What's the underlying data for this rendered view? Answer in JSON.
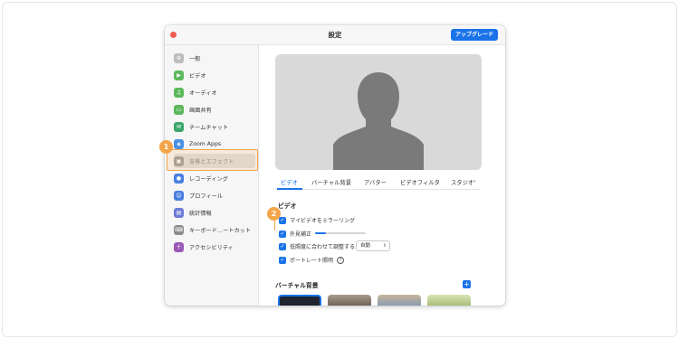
{
  "window": {
    "title": "設定",
    "upgrade_label": "アップグレード"
  },
  "sidebar": {
    "items": [
      {
        "label": "一般",
        "icon": "gear-icon",
        "color": "#bdbdbd"
      },
      {
        "label": "ビデオ",
        "icon": "video-icon",
        "color": "#5cb85c"
      },
      {
        "label": "オーディオ",
        "icon": "headphones-icon",
        "color": "#5cb85c"
      },
      {
        "label": "画面共有",
        "icon": "screen-share-icon",
        "color": "#5cb85c"
      },
      {
        "label": "チームチャット",
        "icon": "chat-icon",
        "color": "#3aa76d"
      },
      {
        "label": "Zoom Apps",
        "icon": "zoom-apps-icon",
        "color": "#4a90e2"
      },
      {
        "label": "背景とエフェクト",
        "icon": "background-icon",
        "color": "#9e9e9e"
      },
      {
        "label": "レコーディング",
        "icon": "record-icon",
        "color": "#4a7fe0"
      },
      {
        "label": "プロフィール",
        "icon": "profile-icon",
        "color": "#4a7fe0"
      },
      {
        "label": "統計情報",
        "icon": "statistics-icon",
        "color": "#6b7bd6"
      },
      {
        "label": "キーボード…ートカット",
        "icon": "keyboard-icon",
        "color": "#8c8c8c"
      },
      {
        "label": "アクセシビリティ",
        "icon": "accessibility-icon",
        "color": "#9b59b6"
      }
    ]
  },
  "callouts": {
    "one": "1",
    "two": "2"
  },
  "tabs": [
    "ビデオ",
    "バーチャル背景",
    "アバター",
    "ビデオフィルタ",
    "スタジオ"
  ],
  "video_section": {
    "title": "ビデオ",
    "mirror_label": "マイビデオをミラーリング",
    "touch_up_label": "外見補正",
    "low_light_label": "低照度に合わせて調整する",
    "low_light_value": "自動",
    "portrait_label": "ポートレート照明",
    "touch_up_level": 0.22
  },
  "virtual_background": {
    "title": "バーチャル背景"
  },
  "colors": {
    "accent": "#1a73e8",
    "callout": "#f4a54a"
  }
}
